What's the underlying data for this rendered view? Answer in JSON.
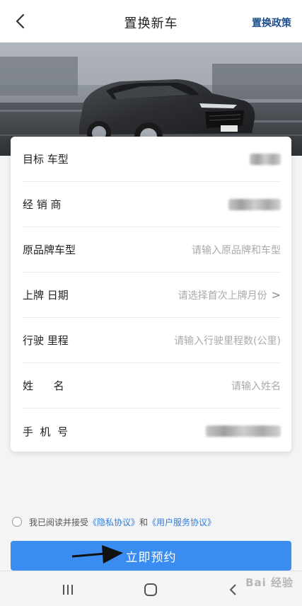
{
  "header": {
    "title": "置换新车",
    "policy_label": "置换政策"
  },
  "form": {
    "rows": [
      {
        "label": "目标 车型",
        "value": "",
        "placeholder": "",
        "blurred": true
      },
      {
        "label": "经 销 商",
        "value": "",
        "placeholder": "",
        "blurred": true
      },
      {
        "label": "原品牌车型",
        "value": "",
        "placeholder": "请输入原品牌和车型",
        "blurred": false
      },
      {
        "label": "上牌 日期",
        "value": "",
        "placeholder": "请选择首次上牌月份",
        "blurred": false,
        "chevron": ">"
      },
      {
        "label": "行驶 里程",
        "value": "",
        "placeholder": "请输入行驶里程数(公里)",
        "blurred": false
      },
      {
        "label": "姓      名",
        "value": "",
        "placeholder": "请输入姓名",
        "blurred": false
      },
      {
        "label": "手  机  号",
        "value": "",
        "placeholder": "",
        "blurred": true
      }
    ]
  },
  "agreement": {
    "prefix": "我已阅读并接受",
    "privacy": "《隐私协议》",
    "and": "和",
    "service": "《用户服务协议》",
    "checked": false
  },
  "submit": {
    "label": "立即预约"
  },
  "watermark": {
    "text": "Bai 经验"
  },
  "colors": {
    "primary": "#3b8cf0",
    "link": "#2f7de1",
    "policy": "#1d4f8b"
  }
}
